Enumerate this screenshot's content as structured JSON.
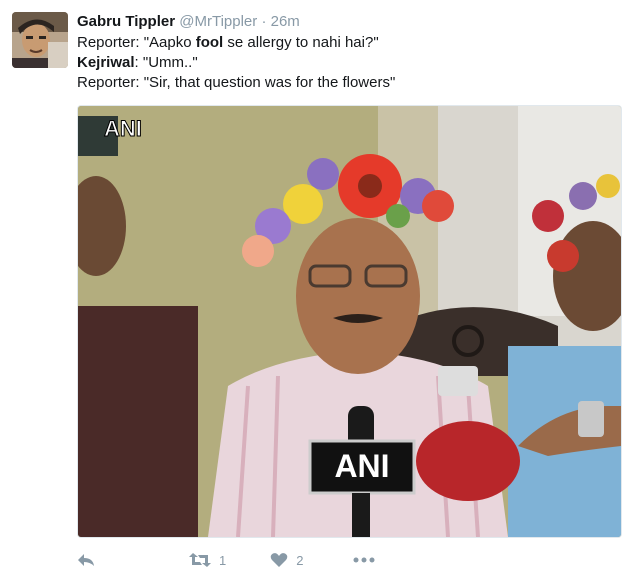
{
  "tweet": {
    "author_name": "Gabru Tippler",
    "handle": "@MrTippler",
    "separator": "·",
    "time": "26m",
    "lines": [
      {
        "prefix": "Reporter: \"Aapko ",
        "bold": "fool",
        "suffix": " se allergy to nahi hai?\""
      },
      {
        "bold": "Kejriwal",
        "suffix": ": \"Umm..\""
      },
      {
        "text": "Reporter: \"Sir, that question was for the flowers\""
      }
    ]
  },
  "media": {
    "watermark": "ANI",
    "mic_label": "ANI"
  },
  "actions": {
    "reply_icon": "reply-icon",
    "retweet_icon": "retweet-icon",
    "retweet_count": "1",
    "like_icon": "heart-icon",
    "like_count": "2",
    "more_icon": "more-icon"
  },
  "colors": {
    "name": "#14171a",
    "meta": "#8899a6",
    "action_grey": "#8899a6"
  }
}
